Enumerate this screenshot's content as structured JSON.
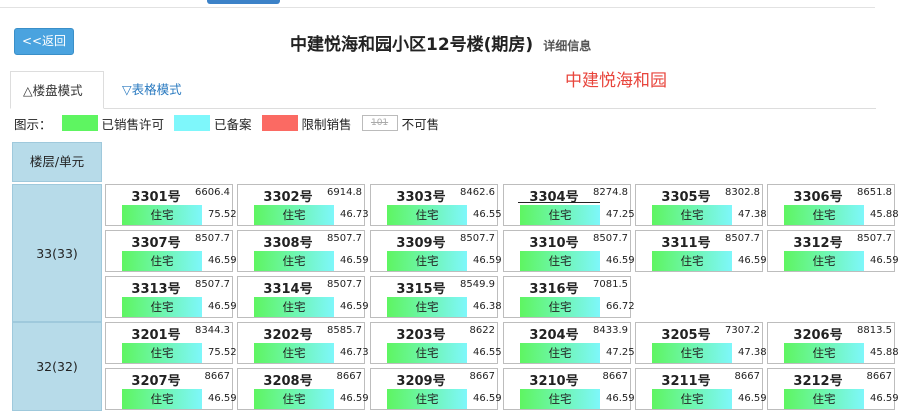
{
  "header": {
    "back_label": "<<返回",
    "title": "中建悦海和园小区12号楼(期房)",
    "subtitle": "详细信息",
    "watermark": "中建悦海和园"
  },
  "tabs": [
    {
      "label": "△楼盘模式",
      "active": true
    },
    {
      "label": "▽表格模式",
      "active": false
    }
  ],
  "legend": {
    "label": "图示：",
    "items": [
      {
        "label": "已销售许可",
        "color": "#5ef561"
      },
      {
        "label": "已备案",
        "color": "#7ef7fb"
      },
      {
        "label": "限制销售",
        "color": "#fb6a63"
      },
      {
        "label": "不可售",
        "swatch_text": "101"
      }
    ]
  },
  "table": {
    "header_label": "楼层/单元",
    "floors": [
      {
        "label": "33(33)",
        "units": [
          {
            "num": "3301号",
            "price": "6606.4",
            "use": "住宅",
            "area": "75.52"
          },
          {
            "num": "3302号",
            "price": "6914.8",
            "use": "住宅",
            "area": "46.73"
          },
          {
            "num": "3303号",
            "price": "8462.6",
            "use": "住宅",
            "area": "46.55"
          },
          {
            "num": "3304号",
            "price": "8274.8",
            "use": "住宅",
            "area": "47.25",
            "underlined": true
          },
          {
            "num": "3305号",
            "price": "8302.8",
            "use": "住宅",
            "area": "47.38"
          },
          {
            "num": "3306号",
            "price": "8651.8",
            "use": "住宅",
            "area": "45.88"
          },
          {
            "num": "3307号",
            "price": "8507.7",
            "use": "住宅",
            "area": "46.59"
          },
          {
            "num": "3308号",
            "price": "8507.7",
            "use": "住宅",
            "area": "46.59"
          },
          {
            "num": "3309号",
            "price": "8507.7",
            "use": "住宅",
            "area": "46.59"
          },
          {
            "num": "3310号",
            "price": "8507.7",
            "use": "住宅",
            "area": "46.59"
          },
          {
            "num": "3311号",
            "price": "8507.7",
            "use": "住宅",
            "area": "46.59"
          },
          {
            "num": "3312号",
            "price": "8507.7",
            "use": "住宅",
            "area": "46.59"
          },
          {
            "num": "3313号",
            "price": "8507.7",
            "use": "住宅",
            "area": "46.59"
          },
          {
            "num": "3314号",
            "price": "8507.7",
            "use": "住宅",
            "area": "46.59"
          },
          {
            "num": "3315号",
            "price": "8549.9",
            "use": "住宅",
            "area": "46.38"
          },
          {
            "num": "3316号",
            "price": "7081.5",
            "use": "住宅",
            "area": "66.72"
          }
        ]
      },
      {
        "label": "32(32)",
        "units": [
          {
            "num": "3201号",
            "price": "8344.3",
            "use": "住宅",
            "area": "75.52"
          },
          {
            "num": "3202号",
            "price": "8585.7",
            "use": "住宅",
            "area": "46.73"
          },
          {
            "num": "3203号",
            "price": "8622",
            "use": "住宅",
            "area": "46.55"
          },
          {
            "num": "3204号",
            "price": "8433.9",
            "use": "住宅",
            "area": "47.25"
          },
          {
            "num": "3205号",
            "price": "7307.2",
            "use": "住宅",
            "area": "47.38"
          },
          {
            "num": "3206号",
            "price": "8813.5",
            "use": "住宅",
            "area": "45.88"
          },
          {
            "num": "3207号",
            "price": "8667",
            "use": "住宅",
            "area": "46.59"
          },
          {
            "num": "3208号",
            "price": "8667",
            "use": "住宅",
            "area": "46.59"
          },
          {
            "num": "3209号",
            "price": "8667",
            "use": "住宅",
            "area": "46.59"
          },
          {
            "num": "3210号",
            "price": "8667",
            "use": "住宅",
            "area": "46.59"
          },
          {
            "num": "3211号",
            "price": "8667",
            "use": "住宅",
            "area": "46.59"
          },
          {
            "num": "3212号",
            "price": "8667",
            "use": "住宅",
            "area": "46.59"
          }
        ]
      }
    ]
  }
}
